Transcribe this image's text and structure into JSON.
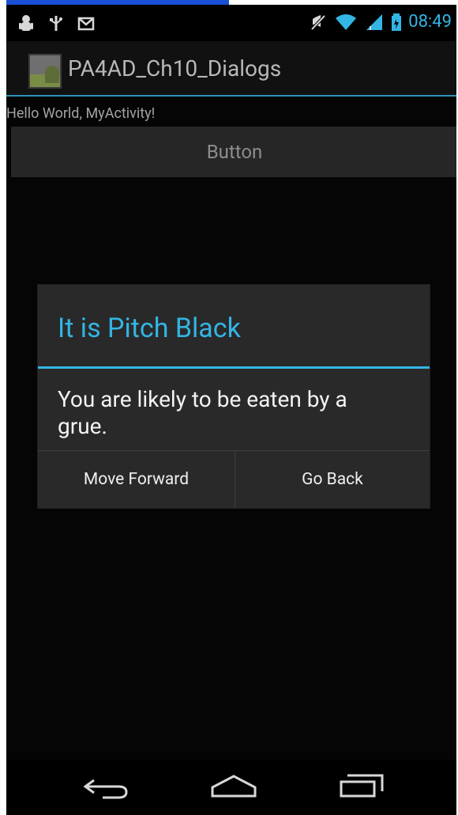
{
  "status_bar": {
    "time": "08:49",
    "icons": [
      "android-debug-icon",
      "usb-icon",
      "gmail-icon",
      "mute-icon",
      "wifi-icon",
      "signal-icon",
      "battery-icon"
    ]
  },
  "action_bar": {
    "title": "PA4AD_Ch10_Dialogs"
  },
  "content": {
    "hello_text": "Hello World, MyActivity!",
    "button_label": "Button"
  },
  "dialog": {
    "title": "It is Pitch Black",
    "message": "You are likely to be eaten by a grue.",
    "buttons": [
      {
        "label": "Move Forward"
      },
      {
        "label": "Go Back"
      }
    ]
  },
  "navigation_bar": {
    "icons": [
      "back-icon",
      "home-icon",
      "recent-apps-icon"
    ]
  },
  "colors": {
    "accent": "#33b5e5",
    "screen_background": "#050505",
    "dialog_background": "#292929"
  }
}
